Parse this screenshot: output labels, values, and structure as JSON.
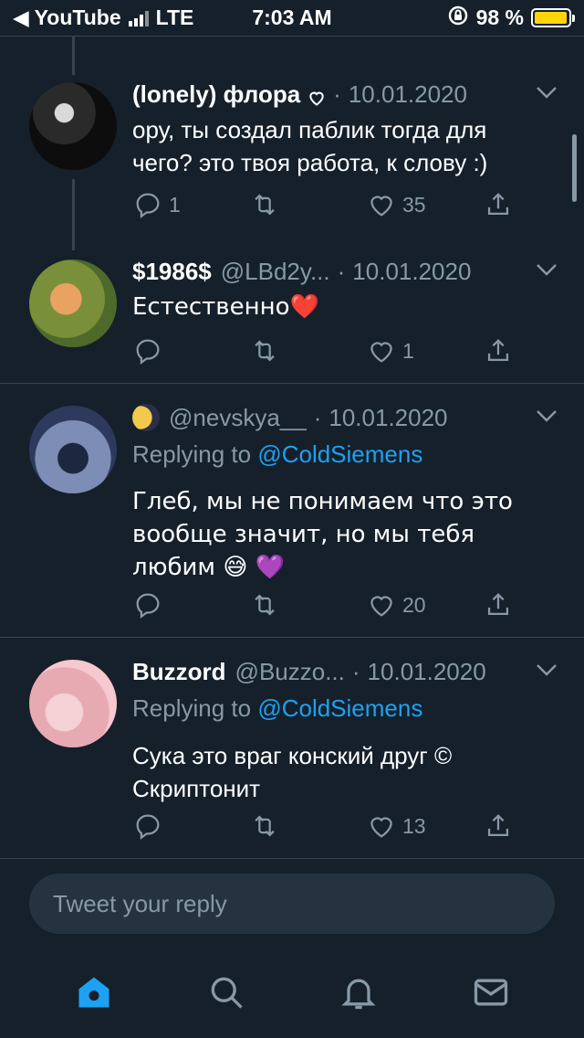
{
  "status_bar": {
    "back_app": "◀ YouTube",
    "network": "LTE",
    "time": "7:03 AM",
    "battery_percent": "98 %",
    "battery_level": 0.98
  },
  "tweets": [
    {
      "name": "(lonely) флора",
      "handle": "",
      "date": "10.01.2020",
      "replying_to": "",
      "text": "ору, ты создал паблик тогда для чего? это твоя работа, к слову :)",
      "replies": "1",
      "retweets": "",
      "likes": "35"
    },
    {
      "name": "$1986$",
      "handle": "@LBd2y...",
      "date": "10.01.2020",
      "replying_to": "",
      "text": "Естественно❤️",
      "replies": "",
      "retweets": "",
      "likes": "1"
    },
    {
      "name": "",
      "handle": "@nevskya__",
      "date": "10.01.2020",
      "replying_label": "Replying to",
      "replying_to": "@ColdSiemens",
      "text": "Глеб, мы не понимаем что это вообще значит, но мы тебя любим 😅 💜",
      "replies": "",
      "retweets": "",
      "likes": "20"
    },
    {
      "name": "Buzzord",
      "handle": "@Buzzo...",
      "date": "10.01.2020",
      "replying_label": "Replying to",
      "replying_to": "@ColdSiemens",
      "text": "Сука это враг конский друг © Скриптонит",
      "replies": "",
      "retweets": "",
      "likes": "13"
    }
  ],
  "separator": "·",
  "composer": {
    "placeholder": "Tweet your reply"
  },
  "tabs": [
    "home-icon",
    "search-icon",
    "notifications-icon",
    "messages-icon"
  ],
  "colors": {
    "background": "#15202b",
    "accent": "#1da1f2",
    "muted": "#8899a6",
    "battery": "#ffd60a"
  }
}
